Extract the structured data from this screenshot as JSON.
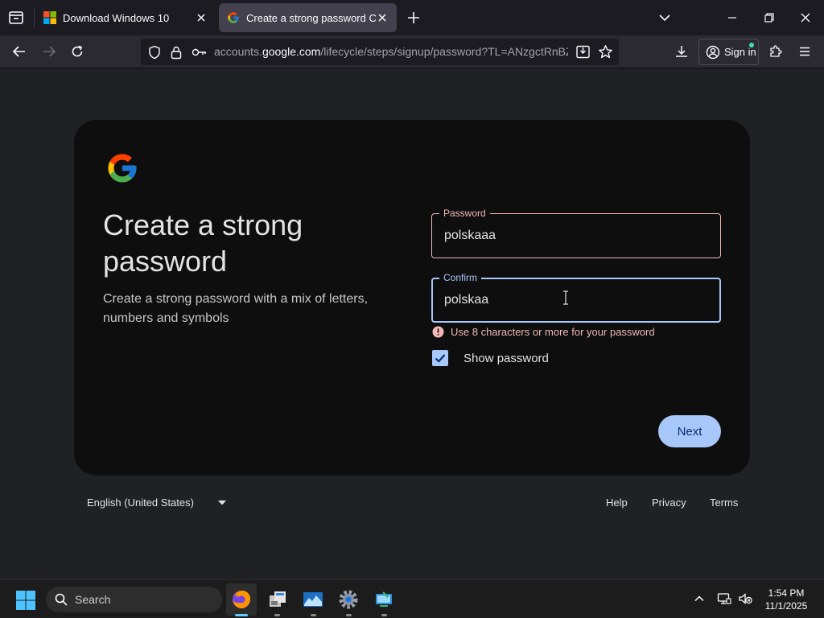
{
  "browser": {
    "tabs": [
      {
        "title": "Download Windows 10",
        "active": false
      },
      {
        "title": "Create a strong password Creat",
        "active": true
      }
    ],
    "url_prefix": "accounts.",
    "url_host": "google.com",
    "url_path": "/lifecycle/steps/signup/password?TL=ANzgctRnBZ",
    "sign_in_label": "Sign in"
  },
  "page": {
    "heading": "Create a strong password",
    "subtext": "Create a strong password with a mix of letters, numbers and symbols",
    "password": {
      "label": "Password",
      "value": "polskaaa"
    },
    "confirm": {
      "label": "Confirm",
      "value": "polskaa"
    },
    "error": "Use 8 characters or more for your password",
    "show_password": {
      "label": "Show password",
      "checked": true
    },
    "next_label": "Next"
  },
  "footer": {
    "language": "English (United States)",
    "help": "Help",
    "privacy": "Privacy",
    "terms": "Terms"
  },
  "taskbar": {
    "search_placeholder": "Search",
    "time": "1:54 PM",
    "date": "11/1/2025"
  },
  "colors": {
    "accent": "#a8c7fa",
    "error": "#f2b8b5",
    "card": "#0e0e0e",
    "page": "#202124"
  }
}
